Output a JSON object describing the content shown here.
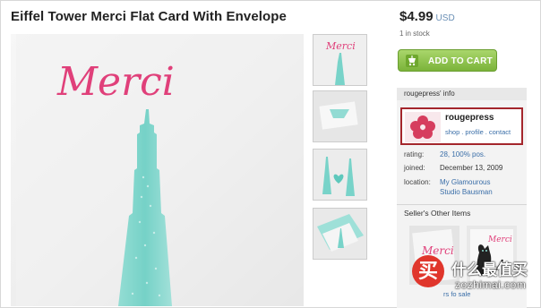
{
  "listing": {
    "title": "Eiffel Tower Merci Flat Card With Envelope",
    "price": "$4.99",
    "currency": "USD",
    "stock": "1 in stock",
    "add_to_cart_label": "ADD TO CART"
  },
  "main_image": {
    "card_text": "Merci"
  },
  "thumbnails": [
    {
      "card_text": "Merci"
    },
    {
      "card_text": ""
    },
    {
      "card_text": ""
    },
    {
      "card_text": ""
    }
  ],
  "seller_info": {
    "header": "rougepress' info",
    "shop_name": "rougepress",
    "links": [
      "shop",
      "profile",
      "contact"
    ],
    "rating_label": "rating:",
    "rating_value": "28, 100% pos.",
    "joined_label": "joined:",
    "joined_value": "December 13, 2009",
    "location_label": "location:",
    "location_line1": "My Glamourous",
    "location_line2": "Studio Bausman"
  },
  "other_items": {
    "header": "Seller's Other Items",
    "link_fragment": "rs fo sale",
    "items": [
      {
        "card_text": "Merci"
      },
      {
        "card_text": "Merci"
      }
    ]
  },
  "watermark": {
    "badge_char": "买",
    "text_cn": "什么最值买",
    "text_en": "zozhimai.com"
  },
  "colors": {
    "accent_pink": "#e0407a",
    "tiffany": "#78d3c9",
    "cart_green": "#8cc24a",
    "link_blue": "#3a6ea8",
    "highlight_red": "#a4262c"
  }
}
